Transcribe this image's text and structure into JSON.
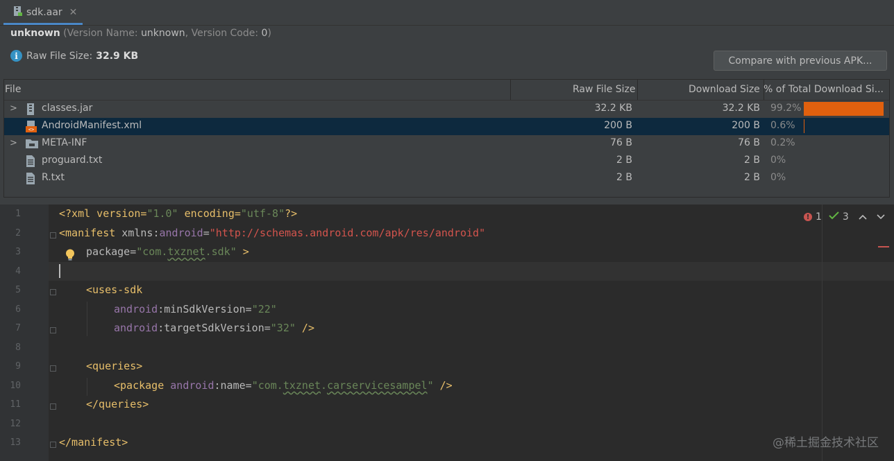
{
  "tab": {
    "label": "sdk.aar",
    "close": "✕"
  },
  "header": {
    "name": "unknown",
    "version_open": " (Version Name: ",
    "version_name": "unknown",
    "version_code_label": ", Version Code: ",
    "version_code": "0",
    "version_close": ")",
    "raw_size_label": "Raw File Size:",
    "raw_size_value": "32.9 KB",
    "compare_button": "Compare with previous APK..."
  },
  "table": {
    "columns": [
      "File",
      "Raw File Size",
      "Download Size",
      "% of Total Download Si..."
    ],
    "rows": [
      {
        "name": "classes.jar",
        "raw": "32.2 KB",
        "download": "32.2 KB",
        "percent": "99.2%",
        "fraction": 0.992,
        "expandable": true,
        "icon": "jar-icon"
      },
      {
        "name": "AndroidManifest.xml",
        "raw": "200 B",
        "download": "200 B",
        "percent": "0.6%",
        "fraction": 0.006,
        "expandable": false,
        "icon": "xml-file-icon",
        "selected": true
      },
      {
        "name": "META-INF",
        "raw": "76 B",
        "download": "76 B",
        "percent": "0.2%",
        "fraction": 0.002,
        "expandable": true,
        "icon": "folder-icon"
      },
      {
        "name": "proguard.txt",
        "raw": "2 B",
        "download": "2 B",
        "percent": "0%",
        "fraction": 0,
        "expandable": false,
        "icon": "text-file-icon"
      },
      {
        "name": "R.txt",
        "raw": "2 B",
        "download": "2 B",
        "percent": "0%",
        "fraction": 0,
        "expandable": false,
        "icon": "text-file-icon"
      }
    ]
  },
  "editor": {
    "line_numbers": [
      "1",
      "2",
      "3",
      "4",
      "5",
      "6",
      "7",
      "8",
      "9",
      "10",
      "11",
      "12",
      "13"
    ],
    "code": {
      "l1_a": "<?xml version=",
      "l1_b": "\"1.0\"",
      "l1_c": " encoding=",
      "l1_d": "\"utf-8\"",
      "l1_e": "?>",
      "l2_a": "<manifest",
      "l2_b": " xmlns:",
      "l2_c": "android",
      "l2_d": "=",
      "l2_e": "\"http://schemas.android.com/apk/res/android\"",
      "l3_a": "package",
      "l3_b": "=",
      "l3_c": "\"com.",
      "l3_d": "txznet",
      "l3_e": ".sdk\"",
      "l3_f": " >",
      "l5": "<uses-sdk",
      "l6_a": "android",
      "l6_b": ":minSdkVersion=",
      "l6_c": "\"22\"",
      "l7_a": "android",
      "l7_b": ":targetSdkVersion=",
      "l7_c": "\"32\"",
      "l7_d": " />",
      "l9": "<queries>",
      "l10_a": "<package",
      "l10_b": " android",
      "l10_c": ":name=",
      "l10_d": "\"com.",
      "l10_e": "txznet",
      "l10_f": ".",
      "l10_g": "carservicesampel",
      "l10_h": "\"",
      "l10_i": " />",
      "l11": "</queries>",
      "l13": "</manifest>"
    },
    "inspections": {
      "errors": "1",
      "warnings": "3"
    }
  },
  "watermark": "@稀土掘金技术社区",
  "colors": {
    "accent": "#4a88c7",
    "bar": "#e0600e",
    "selection": "#0d293e"
  }
}
